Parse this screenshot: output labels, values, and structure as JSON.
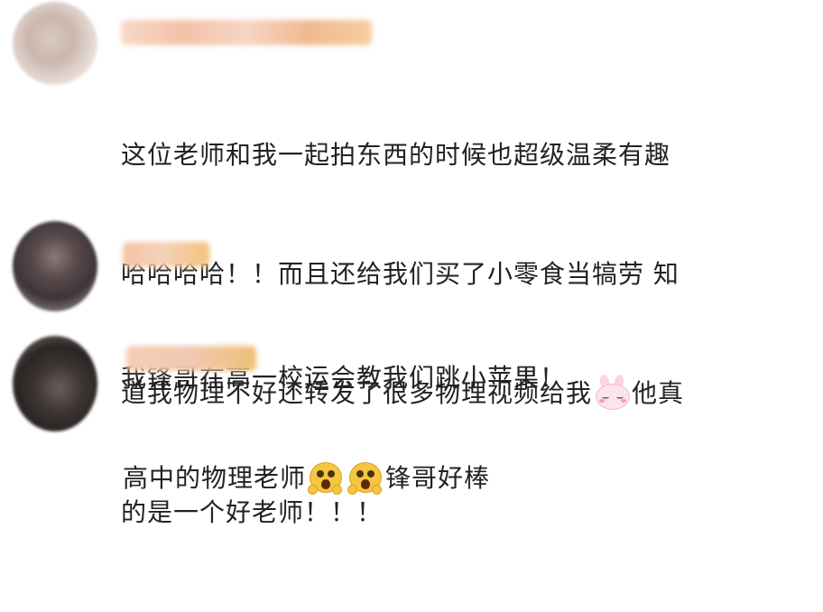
{
  "comments": [
    {
      "lines": [
        "这位老师和我一起拍东西的时候也超级温柔有趣",
        "哈哈哈哈！！而且还给我们买了小零食当犒劳 知",
        "道我物理不好还转发了很多物理视频给我",
        "他真",
        "的是一个好老师！！！"
      ],
      "emoji": "bunny-emoji"
    },
    {
      "text": "我锋哥在高一校运会教我们跳小苹果！"
    },
    {
      "text_before": "高中的物理老师",
      "text_after": "锋哥好棒",
      "emoji": "shocked-face-emoji"
    }
  ]
}
